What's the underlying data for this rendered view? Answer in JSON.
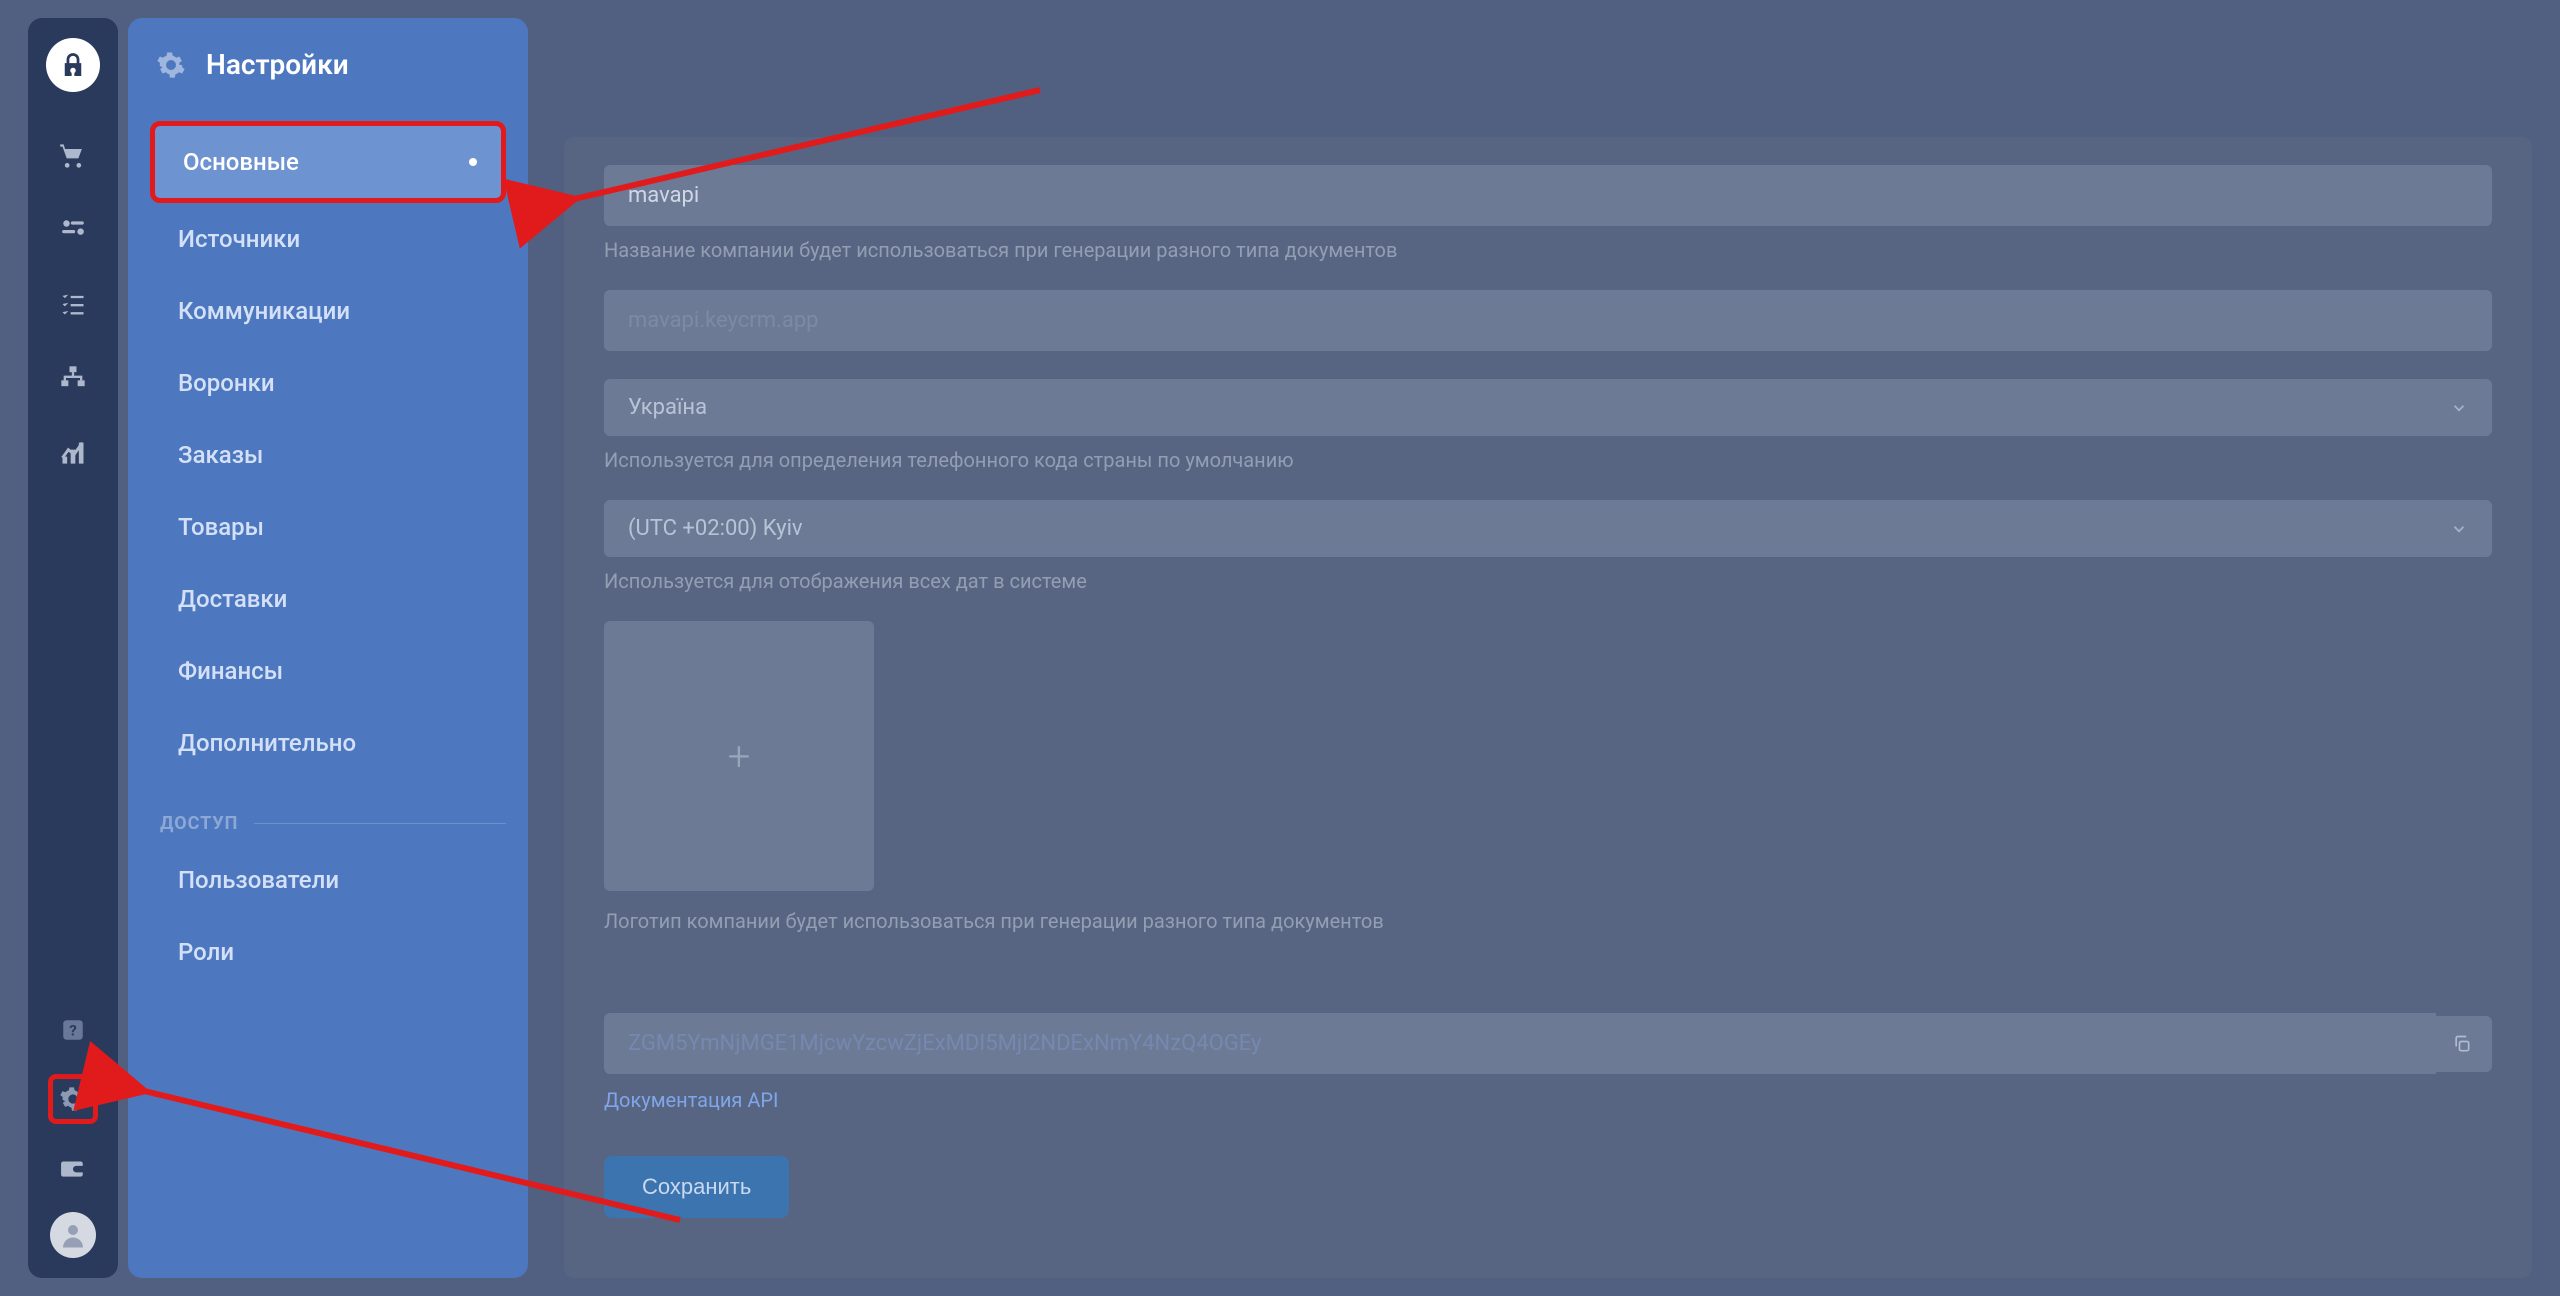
{
  "panel": {
    "title": "Настройки",
    "items": [
      "Основные",
      "Источники",
      "Коммуникации",
      "Воронки",
      "Заказы",
      "Товары",
      "Доставки",
      "Финансы",
      "Дополнительно"
    ],
    "access_section_title": "ДОСТУП",
    "access_items": [
      "Пользователи",
      "Роли"
    ]
  },
  "form": {
    "company_value": "mavapi",
    "company_helper": "Название компании будет использоваться при генерации разного типа документов",
    "domain_value": "mavapi.keycrm.app",
    "country_value": "Україна",
    "country_helper": "Используется для определения телефонного кода страны по умолчанию",
    "tz_value": "(UTC +02:00) Kyiv",
    "tz_helper": "Используется для отображения всех дат в системе",
    "logo_helper": "Логотип компании будет использоваться при генерации разного типа документов",
    "api_key_value": "ZGM5YmNjMGE1MjcwYzcwZjExMDI5MjI2NDExNmY4NzQ4OGEy",
    "api_doc_link": "Документация API",
    "save_label": "Сохранить"
  }
}
